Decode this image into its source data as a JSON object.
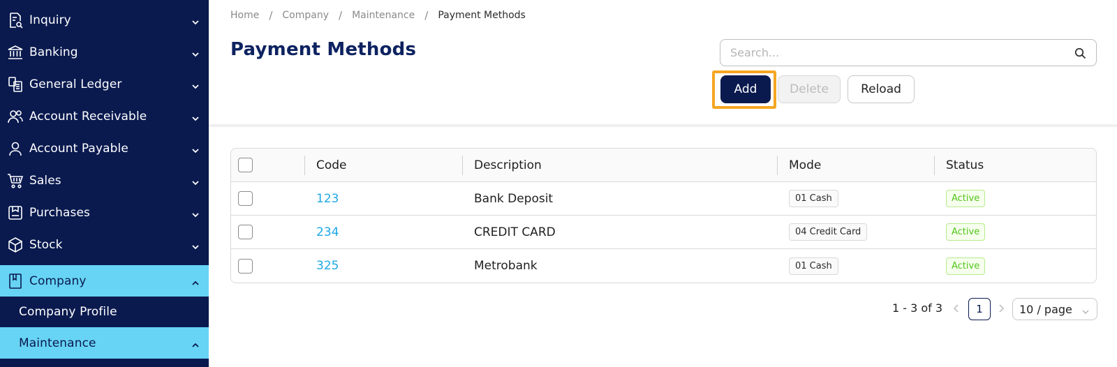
{
  "sidebar": {
    "items": [
      {
        "label": "Inquiry",
        "icon": "inquiry-icon"
      },
      {
        "label": "Banking",
        "icon": "bank-icon"
      },
      {
        "label": "General Ledger",
        "icon": "ledger-icon"
      },
      {
        "label": "Account Receivable",
        "icon": "users-icon"
      },
      {
        "label": "Account Payable",
        "icon": "user-icon"
      },
      {
        "label": "Sales",
        "icon": "cart-icon"
      },
      {
        "label": "Purchases",
        "icon": "purchases-icon"
      },
      {
        "label": "Stock",
        "icon": "box-icon"
      },
      {
        "label": "Company",
        "icon": "book-icon"
      }
    ],
    "subitems": [
      {
        "label": "Company Profile"
      },
      {
        "label": "Maintenance"
      }
    ],
    "colors": {
      "background": "#0a1a4f",
      "active": "#67d4f5"
    }
  },
  "breadcrumb": {
    "items": [
      "Home",
      "Company",
      "Maintenance",
      "Payment Methods"
    ],
    "separator": "/"
  },
  "page": {
    "title": "Payment Methods"
  },
  "search": {
    "placeholder": "Search..."
  },
  "toolbar": {
    "add_label": "Add",
    "delete_label": "Delete",
    "reload_label": "Reload"
  },
  "table": {
    "columns": [
      "Code",
      "Description",
      "Mode",
      "Status"
    ],
    "rows": [
      {
        "code": "123",
        "description": "Bank Deposit",
        "mode": "01 Cash",
        "status": "Active"
      },
      {
        "code": "234",
        "description": "CREDIT CARD",
        "mode": "04 Credit Card",
        "status": "Active"
      },
      {
        "code": "325",
        "description": "Metrobank",
        "mode": "01 Cash",
        "status": "Active"
      }
    ]
  },
  "pagination": {
    "total_text": "1 - 3 of 3",
    "current_page": "1",
    "page_size": "10 / page"
  }
}
